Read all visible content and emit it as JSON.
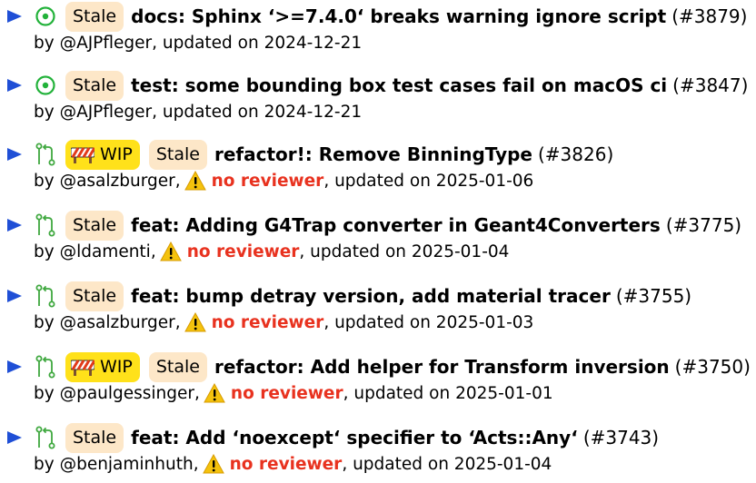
{
  "colors": {
    "triangle": "#1f4fd6",
    "open_icon": "#22b23a",
    "draft_icon": "#3fa83f",
    "stale_badge_bg": "#fde7c8",
    "wip_badge_bg": "#ffe11a",
    "no_reviewer": "#e8321f"
  },
  "items": [
    {
      "status_icon": "open-circle-icon",
      "wip_label": "",
      "stale_label": "Stale",
      "title": "docs: Sphinx ‘>=7.4.0‘ breaks warning ignore script",
      "pr_number": "(#3879)",
      "by_text": "by @AJPfleger, updated on 2024-12-21",
      "warning_text": "",
      "after_text": ""
    },
    {
      "status_icon": "open-circle-icon",
      "wip_label": "",
      "stale_label": "Stale",
      "title": "test: some bounding box test cases fail on macOS ci",
      "pr_number": "(#3847)",
      "by_text": "by @AJPfleger, updated on 2024-12-21",
      "warning_text": "",
      "after_text": ""
    },
    {
      "status_icon": "pull-request-icon",
      "wip_label": "WIP",
      "stale_label": "Stale",
      "title": "refactor!: Remove BinningType",
      "pr_number": "(#3826)",
      "by_text": "by @asalzburger,",
      "warning_text": "no reviewer",
      "after_text": ", updated on 2025-01-06"
    },
    {
      "status_icon": "pull-request-icon",
      "wip_label": "",
      "stale_label": "Stale",
      "title": "feat: Adding G4Trap converter in Geant4Converters",
      "pr_number": "(#3775)",
      "by_text": "by @ldamenti,",
      "warning_text": "no reviewer",
      "after_text": ", updated on 2025-01-04"
    },
    {
      "status_icon": "pull-request-icon",
      "wip_label": "",
      "stale_label": "Stale",
      "title": "feat: bump detray version, add material tracer",
      "pr_number": "(#3755)",
      "by_text": "by @asalzburger,",
      "warning_text": "no reviewer",
      "after_text": ", updated on 2025-01-03"
    },
    {
      "status_icon": "pull-request-icon",
      "wip_label": "WIP",
      "stale_label": "Stale",
      "title": "refactor: Add helper for Transform inversion",
      "pr_number": "(#3750)",
      "by_text": "by @paulgessinger,",
      "warning_text": "no reviewer",
      "after_text": ", updated on 2025-01-01"
    },
    {
      "status_icon": "pull-request-icon",
      "wip_label": "",
      "stale_label": "Stale",
      "title": "feat: Add ‘noexcept‘ specifier to ‘Acts::Any‘",
      "pr_number": "(#3743)",
      "by_text": "by @benjaminhuth,",
      "warning_text": "no reviewer",
      "after_text": ", updated on 2025-01-04"
    }
  ]
}
